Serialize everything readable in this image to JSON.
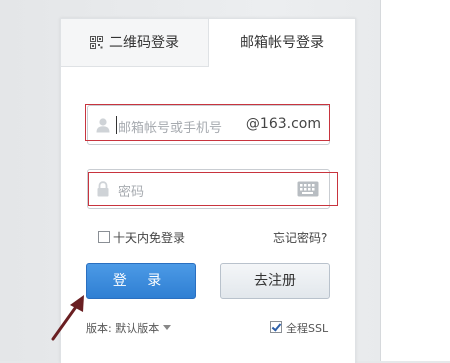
{
  "tabs": {
    "qr_label": "二维码登录",
    "email_label": "邮箱帐号登录"
  },
  "login_form": {
    "username_placeholder": "邮箱帐号或手机号",
    "domain_suffix": "@163.com",
    "password_placeholder": "密码",
    "remember_label": "十天内免登录",
    "forgot_label": "忘记密码?",
    "login_button": "登 录",
    "register_button": "去注册"
  },
  "footer": {
    "version_label": "版本: 默认版本",
    "ssl_label": "全程SSL",
    "ssl_checked": true
  },
  "icons": {
    "qr": "qr-code-icon",
    "user": "user-icon",
    "lock": "lock-icon",
    "keyboard": "keyboard-icon",
    "arrow": "annotation-arrow-icon"
  },
  "colors": {
    "login_button": "#3a88da",
    "highlight_box": "#c8343e",
    "arrow": "#6a1f22"
  }
}
